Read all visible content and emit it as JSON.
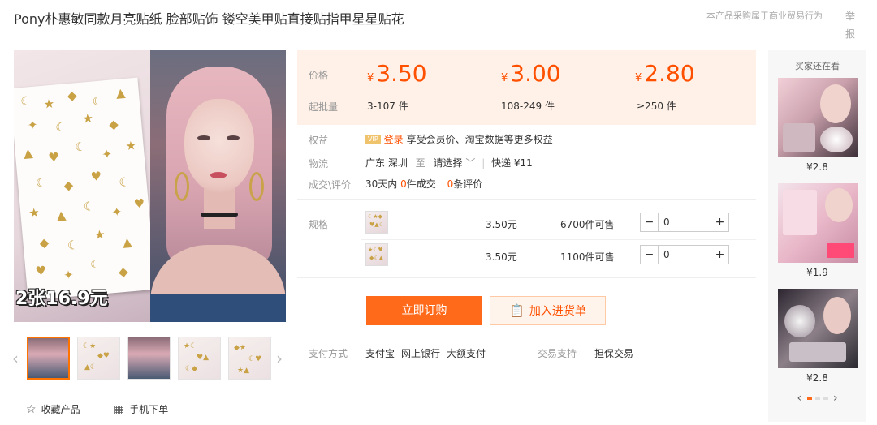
{
  "header": {
    "title": "Pony朴惠敏同款月亮贴纸 脸部贴饰 镂空美甲贴直接贴指甲星星贴花",
    "trade_note": "本产品采购属于商业贸易行为",
    "report": "举报"
  },
  "gallery": {
    "promo_text": "2张16.9元",
    "thumbnails": [
      {
        "kind": "combo"
      },
      {
        "kind": "sheet"
      },
      {
        "kind": "girl"
      },
      {
        "kind": "sheet"
      },
      {
        "kind": "sheet"
      }
    ],
    "actions": {
      "favorite": "收藏产品",
      "mobile_order": "手机下单"
    }
  },
  "pricing": {
    "price_label": "价格",
    "moq_label": "起批量",
    "currency": "¥",
    "tiers": [
      {
        "price": "3.50",
        "range": "3-107 件"
      },
      {
        "price": "3.00",
        "range": "108-249 件"
      },
      {
        "price": "2.80",
        "range": "≥250 件"
      }
    ],
    "accent_color": "#ff5000"
  },
  "info": {
    "benefit_label": "权益",
    "vip_badge": "VIP",
    "login": "登录",
    "benefit_text": "享受会员价、淘宝数据等更多权益",
    "logistics_label": "物流",
    "origin": "广东 深圳",
    "to": "至",
    "destination": "请选择",
    "shipping": "快递 ¥11",
    "deals_label": "成交\\评价",
    "deals_prefix": "30天内",
    "deals_count": "0",
    "deals_suffix": "件成交",
    "reviews_count": "0",
    "reviews_suffix": "条评价"
  },
  "specs": {
    "label": "规格",
    "items": [
      {
        "price": "3.50元",
        "stock": "6700件可售",
        "qty": "0"
      },
      {
        "price": "3.50元",
        "stock": "1100件可售",
        "qty": "0"
      }
    ]
  },
  "actions": {
    "buy": "立即订购",
    "add_cart": "加入进货单"
  },
  "payment": {
    "label": "支付方式",
    "methods": [
      "支付宝",
      "网上银行",
      "大额支付"
    ],
    "support_label": "交易支持",
    "support_value": "担保交易"
  },
  "rail": {
    "title": "买家还在看",
    "items": [
      {
        "price": "¥2.8"
      },
      {
        "price": "¥1.9"
      },
      {
        "price": "¥2.8"
      }
    ],
    "pager_active": 1,
    "pager_total": 3
  }
}
